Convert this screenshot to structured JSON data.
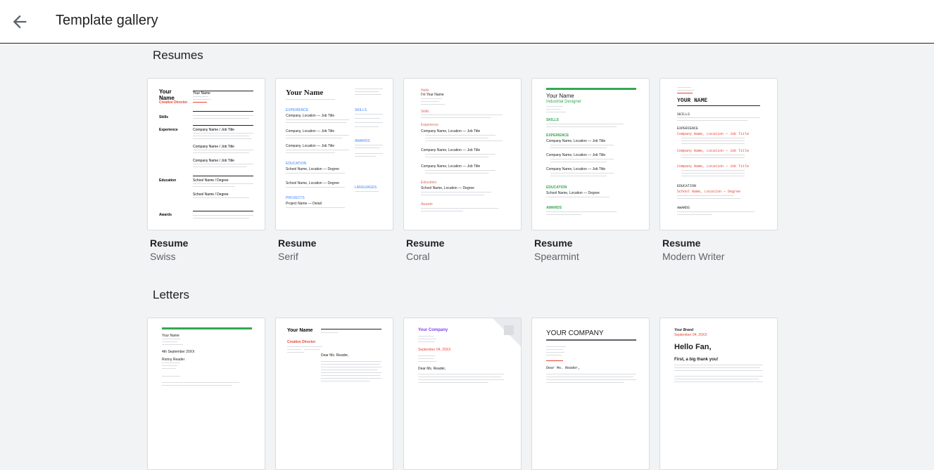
{
  "header": {
    "title": "Template gallery"
  },
  "sections": [
    {
      "label": "Resumes",
      "templates": [
        {
          "title": "Resume",
          "subtitle": "Swiss"
        },
        {
          "title": "Resume",
          "subtitle": "Serif"
        },
        {
          "title": "Resume",
          "subtitle": "Coral"
        },
        {
          "title": "Resume",
          "subtitle": "Spearmint"
        },
        {
          "title": "Resume",
          "subtitle": "Modern Writer"
        }
      ]
    },
    {
      "label": "Letters",
      "templates": [
        {},
        {},
        {},
        {},
        {}
      ]
    }
  ],
  "previews": {
    "swiss": {
      "name": "Your Name",
      "role": "Creative Director",
      "s1": "Skills",
      "s2": "Experience",
      "s3": "Education",
      "s4": "Awards",
      "contact": "Your Name",
      "job": "Company Name / Job Title",
      "school": "School Name / Degree"
    },
    "serif": {
      "name": "Your Name",
      "s1": "EXPERIENCE",
      "s2": "EDUCATION",
      "s3": "PROJECTS",
      "s4": "SKILLS",
      "s5": "AWARDS",
      "s6": "LANGUAGES",
      "job": "Company, Location — Job Title",
      "school": "School Name, Location — Degree",
      "project": "Project Name — Detail"
    },
    "coral": {
      "name": "Hello",
      "name2": "I'm Your Name",
      "s1": "Skills",
      "s2": "Experience",
      "s3": "Education",
      "s4": "Awards",
      "job": "Company Name, Location — Job Title",
      "school": "School Name, Location — Degree"
    },
    "spearmint": {
      "name": "Your Name",
      "role": "Industrial Designer",
      "s1": "SKILLS",
      "s2": "EXPERIENCE",
      "s3": "EDUCATION",
      "s4": "AWARDS",
      "job": "Company Name, Location — Job Title",
      "school": "School Name, Location — Degree"
    },
    "modern": {
      "name": "YOUR NAME",
      "s1": "SKILLS",
      "s2": "EXPERIENCE",
      "s3": "EDUCATION",
      "s4": "AWARDS",
      "job": "Company Name, Location — Job Title",
      "school": "School Name, Location — Degree"
    },
    "l_spearmint": {
      "name": "Your Name",
      "date": "4th September 20XX",
      "recipient": "Ronny Reader"
    },
    "l_swiss": {
      "name": "Your Name",
      "role": "Creative Director",
      "recipient": "Dear Ms. Reader,"
    },
    "l_geometric": {
      "company": "Your Company",
      "date": "September 04, 20XX",
      "greeting": "Dear Ms. Reader,"
    },
    "l_business": {
      "company": "YOUR COMPANY",
      "greeting": "Dear Ms. Reader,"
    },
    "l_playful": {
      "brand": "Your Brand",
      "date": "September 04, 20XX",
      "hello": "Hello Fan,",
      "sub": "First, a big thank you!"
    }
  },
  "colors": {
    "coral": "#e0675a",
    "spearmint": "#34a853",
    "swiss_red": "#ea4335",
    "purple": "#7e3ff2"
  }
}
